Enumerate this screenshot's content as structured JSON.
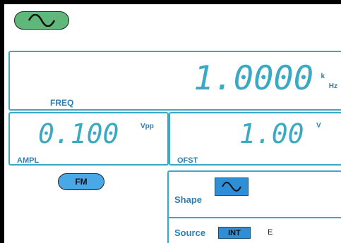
{
  "colors": {
    "accent": "#3aa9c4",
    "label": "#2e7fb2",
    "wave_pill_bg": "#5fb87a",
    "fm_pill_bg": "#4aa8e6",
    "button_bg": "#2e8fd6"
  },
  "header": {
    "waveform_icon": "sine-wave-icon"
  },
  "freq": {
    "value": "1.0000",
    "unit_prefix": "k",
    "unit": "Hz",
    "label": "FREQ"
  },
  "ampl": {
    "value": "0.100",
    "unit": "Vpp",
    "label": "AMPL"
  },
  "ofst": {
    "value": "1.00",
    "unit": "V",
    "label": "OFST"
  },
  "modulation": {
    "mode_label": "FM"
  },
  "shape": {
    "label": "Shape",
    "icon": "sine-wave-icon"
  },
  "source": {
    "label": "Source",
    "selected": "INT",
    "other": "E"
  }
}
